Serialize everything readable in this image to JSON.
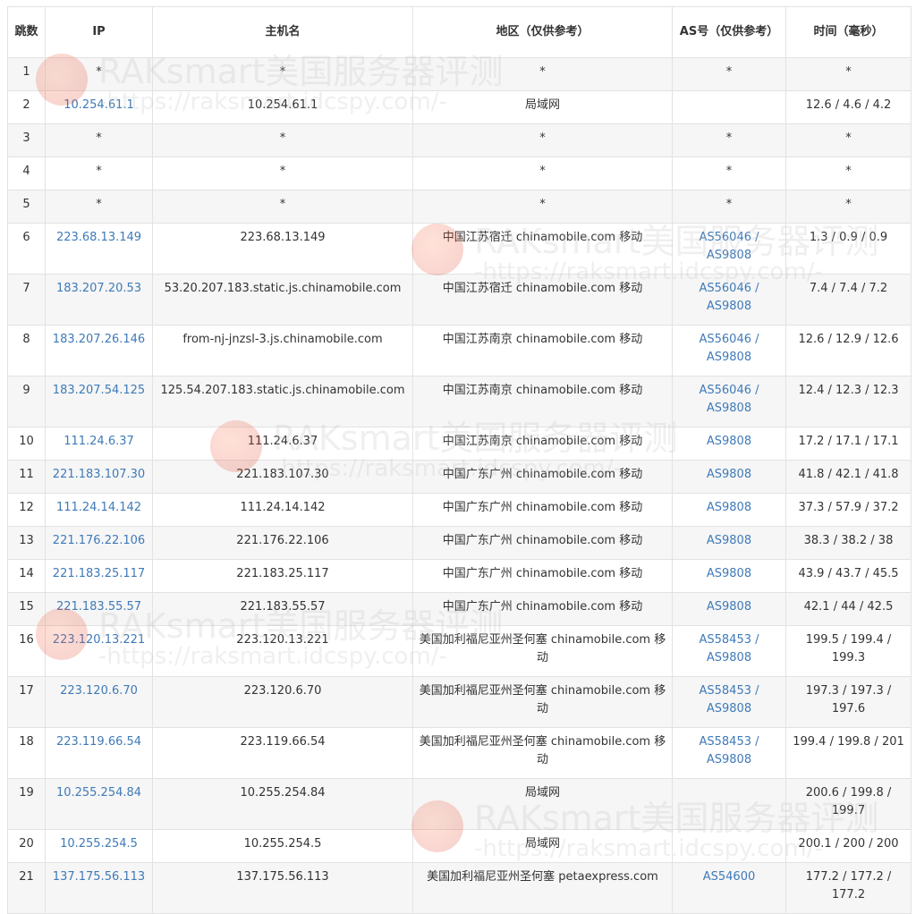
{
  "headers": {
    "hop": "跳数",
    "ip": "IP",
    "host": "主机名",
    "region": "地区（仅供参考）",
    "as": "AS号（仅供参考）",
    "time": "时间（毫秒）"
  },
  "rows": [
    {
      "hop": "1",
      "ip": "*",
      "host": "*",
      "region": "*",
      "as": "*",
      "time": "*"
    },
    {
      "hop": "2",
      "ip": "10.254.61.1",
      "host": "10.254.61.1",
      "region": "局域网",
      "as": "",
      "time": "12.6 / 4.6 / 4.2"
    },
    {
      "hop": "3",
      "ip": "*",
      "host": "*",
      "region": "*",
      "as": "*",
      "time": "*"
    },
    {
      "hop": "4",
      "ip": "*",
      "host": "*",
      "region": "*",
      "as": "*",
      "time": "*"
    },
    {
      "hop": "5",
      "ip": "*",
      "host": "*",
      "region": "*",
      "as": "*",
      "time": "*"
    },
    {
      "hop": "6",
      "ip": "223.68.13.149",
      "host": "223.68.13.149",
      "region": "中国江苏宿迁 chinamobile.com 移动",
      "as": "AS56046 / AS9808",
      "time": "1.3 / 0.9 / 0.9"
    },
    {
      "hop": "7",
      "ip": "183.207.20.53",
      "host": "53.20.207.183.static.js.chinamobile.com",
      "region": "中国江苏宿迁 chinamobile.com 移动",
      "as": "AS56046 / AS9808",
      "time": "7.4 / 7.4 / 7.2"
    },
    {
      "hop": "8",
      "ip": "183.207.26.146",
      "host": "from-nj-jnzsl-3.js.chinamobile.com",
      "region": "中国江苏南京 chinamobile.com 移动",
      "as": "AS56046 / AS9808",
      "time": "12.6 / 12.9 / 12.6"
    },
    {
      "hop": "9",
      "ip": "183.207.54.125",
      "host": "125.54.207.183.static.js.chinamobile.com",
      "region": "中国江苏南京 chinamobile.com 移动",
      "as": "AS56046 / AS9808",
      "time": "12.4 / 12.3 / 12.3"
    },
    {
      "hop": "10",
      "ip": "111.24.6.37",
      "host": "111.24.6.37",
      "region": "中国江苏南京 chinamobile.com 移动",
      "as": "AS9808",
      "time": "17.2 / 17.1 / 17.1"
    },
    {
      "hop": "11",
      "ip": "221.183.107.30",
      "host": "221.183.107.30",
      "region": "中国广东广州 chinamobile.com 移动",
      "as": "AS9808",
      "time": "41.8 / 42.1 / 41.8"
    },
    {
      "hop": "12",
      "ip": "111.24.14.142",
      "host": "111.24.14.142",
      "region": "中国广东广州 chinamobile.com 移动",
      "as": "AS9808",
      "time": "37.3 / 57.9 / 37.2"
    },
    {
      "hop": "13",
      "ip": "221.176.22.106",
      "host": "221.176.22.106",
      "region": "中国广东广州 chinamobile.com 移动",
      "as": "AS9808",
      "time": "38.3 / 38.2 / 38"
    },
    {
      "hop": "14",
      "ip": "221.183.25.117",
      "host": "221.183.25.117",
      "region": "中国广东广州 chinamobile.com 移动",
      "as": "AS9808",
      "time": "43.9 / 43.7 / 45.5"
    },
    {
      "hop": "15",
      "ip": "221.183.55.57",
      "host": "221.183.55.57",
      "region": "中国广东广州 chinamobile.com 移动",
      "as": "AS9808",
      "time": "42.1 / 44 / 42.5"
    },
    {
      "hop": "16",
      "ip": "223.120.13.221",
      "host": "223.120.13.221",
      "region": "美国加利福尼亚州圣何塞 chinamobile.com 移动",
      "as": "AS58453 / AS9808",
      "time": "199.5 / 199.4 / 199.3"
    },
    {
      "hop": "17",
      "ip": "223.120.6.70",
      "host": "223.120.6.70",
      "region": "美国加利福尼亚州圣何塞 chinamobile.com 移动",
      "as": "AS58453 / AS9808",
      "time": "197.3 / 197.3 / 197.6"
    },
    {
      "hop": "18",
      "ip": "223.119.66.54",
      "host": "223.119.66.54",
      "region": "美国加利福尼亚州圣何塞 chinamobile.com 移动",
      "as": "AS58453 / AS9808",
      "time": "199.4 / 199.8 / 201"
    },
    {
      "hop": "19",
      "ip": "10.255.254.84",
      "host": "10.255.254.84",
      "region": "局域网",
      "as": "",
      "time": "200.6 / 199.8 / 199.7"
    },
    {
      "hop": "20",
      "ip": "10.255.254.5",
      "host": "10.255.254.5",
      "region": "局域网",
      "as": "",
      "time": "200.1 / 200 / 200"
    },
    {
      "hop": "21",
      "ip": "137.175.56.113",
      "host": "137.175.56.113",
      "region": "美国加利福尼亚州圣何塞 petaexpress.com",
      "as": "AS54600",
      "time": "177.2 / 177.2 / 177.2"
    }
  ],
  "watermark": {
    "title": "RAKsmart美国服务器评测",
    "url": "-https://raksmart.idcspy.com/-"
  }
}
